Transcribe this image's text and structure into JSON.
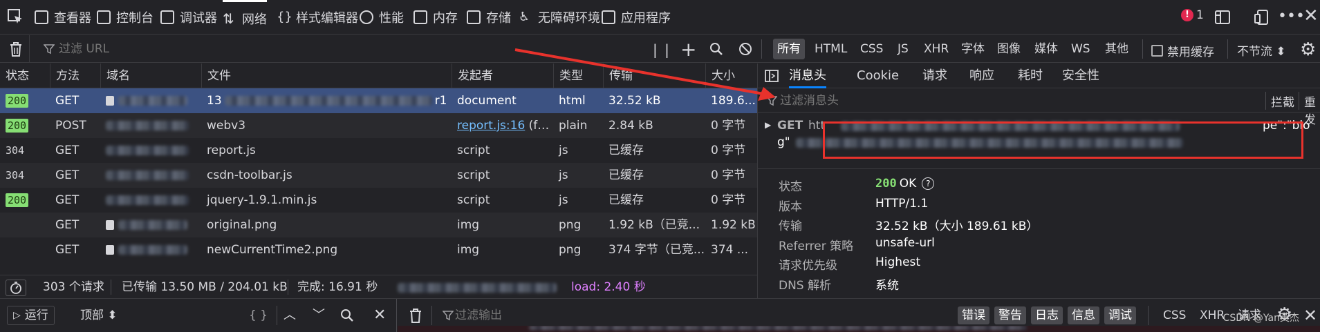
{
  "toolbar": {
    "tabs": [
      {
        "label": "查看器",
        "icon": "inspector-icon"
      },
      {
        "label": "控制台",
        "icon": "console-icon"
      },
      {
        "label": "调试器",
        "icon": "debugger-icon"
      },
      {
        "label": "网络",
        "icon": "network-icon",
        "active": true
      },
      {
        "label": "样式编辑器",
        "icon": "style-editor-icon"
      },
      {
        "label": "性能",
        "icon": "performance-icon"
      },
      {
        "label": "内存",
        "icon": "memory-icon"
      },
      {
        "label": "存储",
        "icon": "storage-icon"
      },
      {
        "label": "无障碍环境",
        "icon": "accessibility-icon"
      },
      {
        "label": "应用程序",
        "icon": "application-icon"
      }
    ],
    "error_count": "1"
  },
  "filterbar": {
    "placeholder": "过滤 URL",
    "types": [
      "所有",
      "HTML",
      "CSS",
      "JS",
      "XHR",
      "字体",
      "图像",
      "媒体",
      "WS",
      "其他"
    ],
    "disable_cache": "禁用缓存",
    "throttle": "不节流 ⬍"
  },
  "table": {
    "columns": [
      "状态",
      "方法",
      "域名",
      "文件",
      "发起者",
      "类型",
      "传输",
      "大小"
    ],
    "rows": [
      {
        "status": "200",
        "method": "GET",
        "lock": true,
        "file": "13",
        "file_tail": "r1",
        "initiator": "document",
        "type": "html",
        "transfer": "32.52 kB",
        "size": "189.6..."
      },
      {
        "status": "200",
        "method": "POST",
        "lock": false,
        "file": "webv3",
        "initiator": "report.js:16",
        "initiator_tail": " (fe...",
        "type": "plain",
        "transfer": "2.84 kB",
        "size": "0 字节"
      },
      {
        "status": "304",
        "method": "GET",
        "lock": false,
        "file": "report.js",
        "initiator": "script",
        "type": "js",
        "transfer": "已缓存",
        "size": "0 字节"
      },
      {
        "status": "304",
        "method": "GET",
        "lock": false,
        "file": "csdn-toolbar.js",
        "initiator": "script",
        "type": "js",
        "transfer": "已缓存",
        "size": "0 字节"
      },
      {
        "status": "200",
        "method": "GET",
        "lock": false,
        "file": "jquery-1.9.1.min.js",
        "initiator": "script",
        "type": "js",
        "transfer": "已缓存",
        "size": "0 字节"
      },
      {
        "status": "",
        "method": "GET",
        "lock": true,
        "file": "original.png",
        "initiator": "img",
        "type": "png",
        "transfer": "1.92 kB（已竞...",
        "size": "1.92 kB"
      },
      {
        "status": "",
        "method": "GET",
        "lock": true,
        "file": "newCurrentTime2.png",
        "initiator": "img",
        "type": "png",
        "transfer": "374 字节（已竞...",
        "size": "374 ..."
      }
    ]
  },
  "summary": {
    "requests": "303 个请求",
    "transferred": "已传输 13.50 MB / 204.01 kB",
    "finish": "完成: 16.91 秒",
    "load": "load: 2.40 秒"
  },
  "details": {
    "tabs": [
      "消息头",
      "Cookie",
      "请求",
      "响应",
      "耗时",
      "安全性"
    ],
    "filter_placeholder": "过滤消息头",
    "block": "拦截",
    "resend": "重发",
    "request_method": "GET",
    "request_url_head": "htt",
    "request_url_tail": "pe\":\"blo",
    "request_url_line2": "g\"",
    "fields": [
      {
        "key": "状态",
        "value": "OK",
        "code": "200"
      },
      {
        "key": "版本",
        "value": "HTTP/1.1"
      },
      {
        "key": "传输",
        "value": "32.52 kB（大小 189.61 kB）"
      },
      {
        "key": "Referrer 策略",
        "value": "unsafe-url"
      },
      {
        "key": "请求优先级",
        "value": "Highest"
      },
      {
        "key": "DNS 解析",
        "value": "系统"
      }
    ]
  },
  "console": {
    "run": "运行",
    "context": "顶部 ⬍",
    "braces": "{ }",
    "filter_placeholder": "过滤输出",
    "levels": [
      "错误",
      "警告",
      "日志",
      "信息",
      "调试"
    ],
    "extra": [
      "CSS",
      "XHR",
      "请求"
    ],
    "watermark": "CSDN @Yan英杰"
  },
  "colors": {
    "background": "#232327",
    "selected_row": "#3c5282",
    "accent": "#0a84ff",
    "status_ok": "#86de74",
    "highlight_box": "#e8322c"
  }
}
